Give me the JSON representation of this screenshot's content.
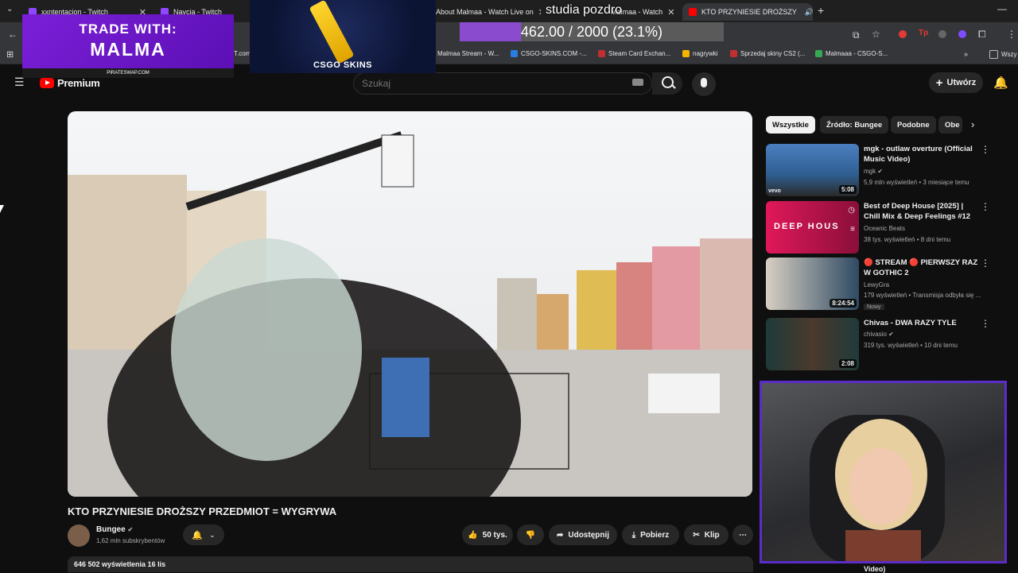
{
  "browser": {
    "tabs": [
      {
        "label": "xxntentacion - Twitch",
        "color": "#9146ff"
      },
      {
        "label": "Navcia - Twitch",
        "color": "#9146ff"
      },
      {
        "label": "About Malmaa - Watch Live on",
        "color": "#9146ff"
      },
      {
        "label": "Malmaa - Watch",
        "color": "#9146ff"
      },
      {
        "label": "KTO PRZYNIESIE DROŻSZY",
        "color": "#ff0000"
      }
    ],
    "new_tab": "+",
    "bookmarks": [
      {
        "label": "Malmaa Stream - W...",
        "color": "#9146ff"
      },
      {
        "label": "CSGO-SKINS.COM -...",
        "color": "#2a7de1"
      },
      {
        "label": "Steam Card Exchan...",
        "color": "#c03030"
      },
      {
        "label": "nagrywki",
        "color": "#f4b400"
      },
      {
        "label": "Sprzedaj skiny CS2 (...",
        "color": "#c03030"
      },
      {
        "label": "Malmaaa - CSGO-S...",
        "color": "#34a853"
      },
      {
        "label": "Wszy",
        "color": "#9a9a9a"
      }
    ],
    "bookmark_fragment": "T.com"
  },
  "overlay": {
    "promo_line1": "TRADE WITH:",
    "promo_line2": "MALMA",
    "promo_url": "PIRATESWAP.COM",
    "csgo_logo": "CSGO  SKINS",
    "studio_text": "studia pozdro",
    "goal_text": "462.00 / 2000 (23.1%)",
    "goal_fraction": 0.231
  },
  "youtube": {
    "logo": "Premium",
    "search_placeholder": "Szukaj",
    "create_label": "Utwórz",
    "video": {
      "title": "KTO PRZYNIESIE DROŻSZY PRZEDMIOT = WYGRYWA",
      "channel": "Bungee",
      "subscribers": "1,62 mln subskrybentów",
      "likes": "50 tys.",
      "share": "Udostępnij",
      "download": "Pobierz",
      "clip": "Klip",
      "views_date": "646 502 wyświetlenia  16 lis"
    },
    "chips": [
      "Wszystkie",
      "Źródło: Bungee",
      "Podobne",
      "Obe"
    ],
    "recommendations": [
      {
        "title": "mgk - outlaw overture (Official Music Video)",
        "channel": "mgk",
        "meta": "5,9 mln wyświetleń • 3 miesiące temu",
        "duration": "5:08"
      },
      {
        "title": "Best of Deep House [2025] | Chill Mix & Deep Feelings #12",
        "channel": "Oceanic Beats",
        "meta": "38 tys. wyświetleń • 8 dni temu",
        "duration": ""
      },
      {
        "title": "🔴 STREAM 🔴 PIERWSZY RAZ W GOTHIC 2",
        "channel": "LewyGra",
        "meta": "179 wyświetleń • Transmisja odbyła się ...",
        "duration": "8:24:54",
        "badge": "Nowy"
      },
      {
        "title": "Chivas - DWA RAZY TYLE",
        "channel": "chivasio",
        "meta": "319 tys. wyświetleń • 10 dni temu",
        "duration": "2:08"
      }
    ],
    "bottom_peek": "Video)"
  }
}
